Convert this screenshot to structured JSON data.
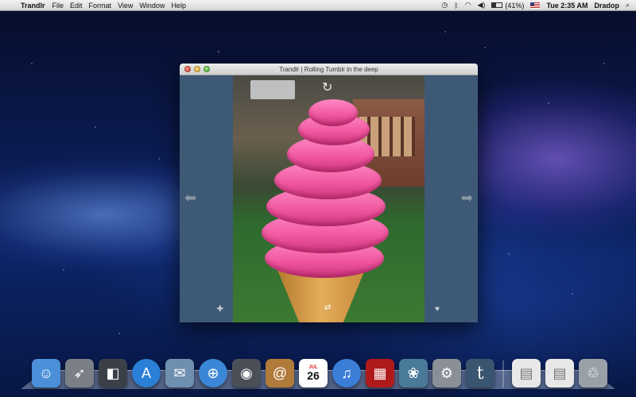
{
  "menubar": {
    "apple_glyph": "",
    "app_name": "Trandlr",
    "menus": [
      "File",
      "Edit",
      "Format",
      "View",
      "Window",
      "Help"
    ],
    "battery": "(41%)",
    "clock": "Tue 2:35 AM",
    "user": "Dradop",
    "icons": [
      "time-machine-icon",
      "bluetooth-icon",
      "wifi-icon",
      "volume-icon",
      "battery-icon",
      "flag-icon",
      "spotlight-icon"
    ]
  },
  "window": {
    "title": "Trandlr | Rolling Tumblr in the deep",
    "panel_color": "#3d5975",
    "left_arrow": "⬅",
    "right_arrow": "➡",
    "add_glyph": "✚",
    "like_glyph": "♥",
    "refresh_glyph": "↻",
    "reblog_glyph": "⇄"
  },
  "dock": {
    "calendar_month": "JUL",
    "calendar_day": "26",
    "tumblr_glyph": "t",
    "items": [
      {
        "name": "finder-icon",
        "glyph": "☺",
        "color": "#4a8fd8"
      },
      {
        "name": "launchpad-icon",
        "glyph": "🚀",
        "color": "#7a7f88"
      },
      {
        "name": "dashboard-icon",
        "glyph": "◧",
        "color": "#3b4048"
      },
      {
        "name": "app-store-icon",
        "glyph": "A",
        "color": "#2a7fd6"
      },
      {
        "name": "mail-icon",
        "glyph": "✉",
        "color": "#6f8fb0"
      },
      {
        "name": "safari-icon",
        "glyph": "⊕",
        "color": "#3b86d6"
      },
      {
        "name": "facetime-icon",
        "glyph": "◉",
        "color": "#4a4f58"
      },
      {
        "name": "address-book-icon",
        "glyph": "@",
        "color": "#b07a3a"
      }
    ],
    "items_after_calendar": [
      {
        "name": "itunes-icon",
        "glyph": "♫",
        "color": "#3a7ed8"
      },
      {
        "name": "photo-booth-icon",
        "glyph": "▦",
        "color": "#b01a1a"
      },
      {
        "name": "iphoto-icon",
        "glyph": "❀",
        "color": "#4a7a9a"
      },
      {
        "name": "system-preferences-icon",
        "glyph": "⚙",
        "color": "#8a8f98"
      }
    ],
    "items_right": [
      {
        "name": "document-icon",
        "glyph": "▤",
        "color": "#e8e8e8"
      },
      {
        "name": "document-icon-2",
        "glyph": "▤",
        "color": "#e8e8e8"
      },
      {
        "name": "trash-icon",
        "glyph": "🗑",
        "color": "#9aa0a8"
      }
    ]
  }
}
